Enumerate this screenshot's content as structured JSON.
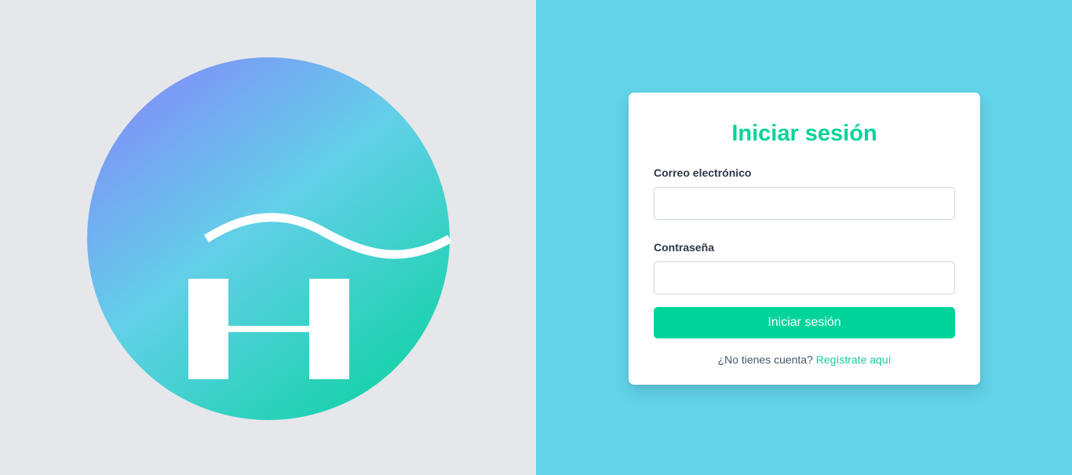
{
  "brand": {
    "logo_icon": "h-wave-logo",
    "gradient_colors": [
      "#7b93f7",
      "#62d3e8",
      "#14d4ac"
    ]
  },
  "login": {
    "title": "Iniciar sesión",
    "email_label": "Correo electrónico",
    "email_value": "",
    "password_label": "Contraseña",
    "password_value": "",
    "submit_label": "Iniciar sesión",
    "no_account_text": "¿No tienes cuenta?",
    "register_link": "Regístrate aquí"
  },
  "colors": {
    "left_bg": "#e5e7eb",
    "right_bg": "#62d3e8",
    "accent": "#00d49b",
    "title": "#06d39a"
  }
}
